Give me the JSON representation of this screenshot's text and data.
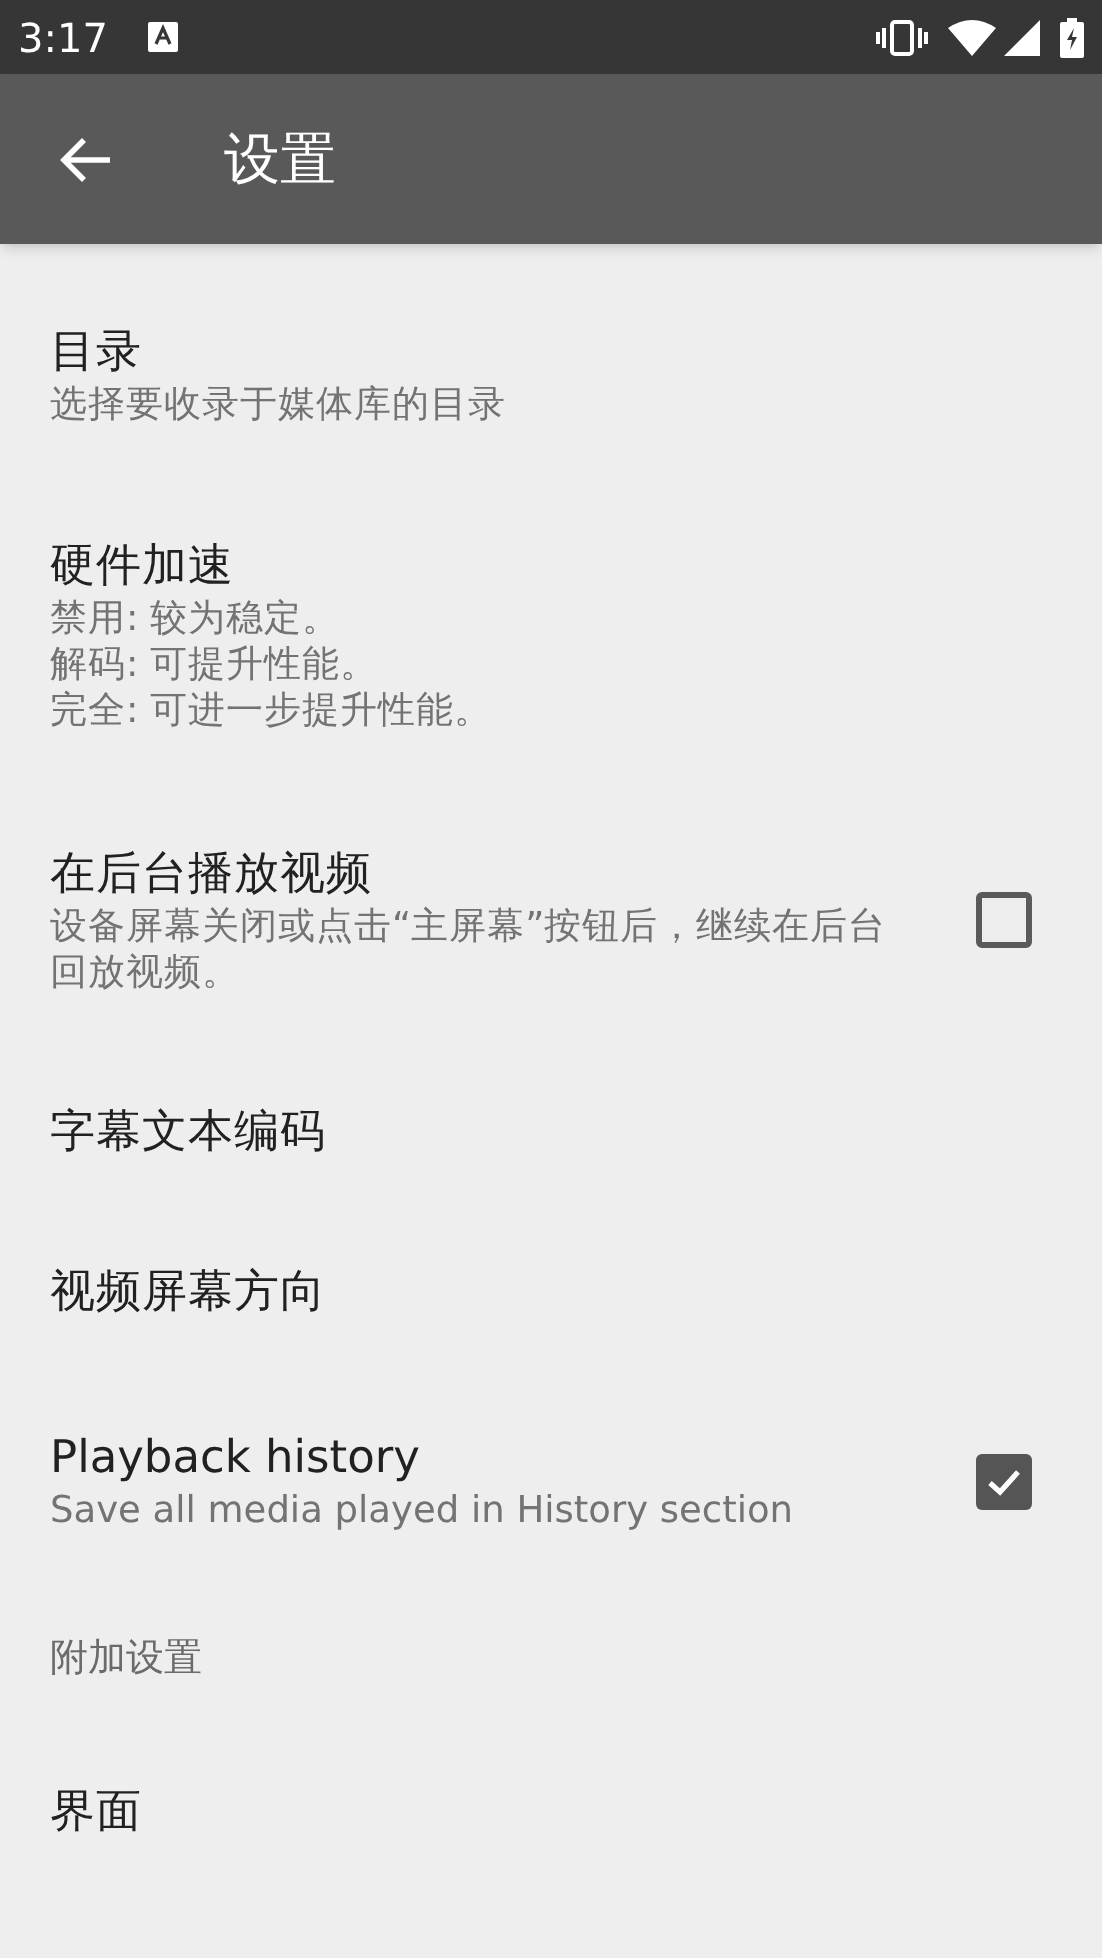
{
  "status_bar": {
    "time": "3:17"
  },
  "toolbar": {
    "title": "设置"
  },
  "items": [
    {
      "kind": "plain",
      "title": "目录",
      "summary": [
        "选择要收录于媒体库的目录"
      ]
    },
    {
      "kind": "plain",
      "title": "硬件加速",
      "summary": [
        "禁用: 较为稳定。",
        "解码: 可提升性能。",
        "完全: 可进一步提升性能。"
      ]
    },
    {
      "kind": "checkbox",
      "title": "在后台播放视频",
      "summary": [
        "设备屏幕关闭或点击“主屏幕”按钮后，继续在后台回放视频。"
      ],
      "checked": false
    },
    {
      "kind": "plain",
      "title": "字幕文本编码"
    },
    {
      "kind": "plain",
      "title": "视频屏幕方向"
    },
    {
      "kind": "checkbox",
      "title": "Playback history",
      "summary": [
        "Save all media played in History section"
      ],
      "checked": true
    },
    {
      "kind": "header",
      "title": "附加设置"
    },
    {
      "kind": "plain",
      "title": "界面"
    }
  ]
}
